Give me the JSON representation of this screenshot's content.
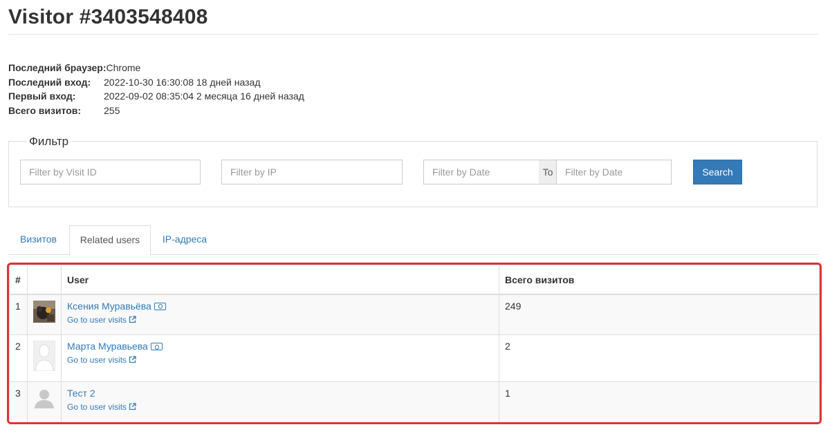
{
  "page": {
    "title": "Visitor #3403548408"
  },
  "info": {
    "last_browser_label": "Последний браузер:",
    "last_browser_value": "Chrome",
    "last_login_label": "Последний вход:",
    "last_login_value": "2022-10-30 16:30:08 18 дней назад",
    "first_login_label": "Первый вход:",
    "first_login_value": "2022-09-02 08:35:04 2 месяца 16 дней назад",
    "total_visits_label": "Всего визитов:",
    "total_visits_value": "255"
  },
  "filter": {
    "legend": "Фильтр",
    "visit_id_placeholder": "Filter by Visit ID",
    "ip_placeholder": "Filter by IP",
    "date_from_placeholder": "Filter by Date",
    "date_to_label": "To",
    "date_to_placeholder": "Filter by Date",
    "search_label": "Search"
  },
  "tabs": [
    {
      "label": "Визитов",
      "active": false
    },
    {
      "label": "Related users",
      "active": true
    },
    {
      "label": "IP-адреса",
      "active": false
    }
  ],
  "table": {
    "headers": {
      "num": "#",
      "avatar": "",
      "user": "User",
      "visits": "Всего визитов"
    },
    "rows": [
      {
        "num": "1",
        "name": "Ксения Муравьёва",
        "link": "Go to user visits",
        "visits": "249",
        "avatar": "photo-avatar",
        "id_badge": true
      },
      {
        "num": "2",
        "name": "Марта Муравьева",
        "link": "Go to user visits",
        "visits": "2",
        "avatar": "silhouette-placeholder-avatar",
        "id_badge": true
      },
      {
        "num": "3",
        "name": "Тест 2",
        "link": "Go to user visits",
        "visits": "1",
        "avatar": "default-user-avatar",
        "id_badge": false
      }
    ]
  },
  "colors": {
    "link": "#337ab7",
    "button": "#337ab7",
    "highlight_border": "#e03232"
  }
}
